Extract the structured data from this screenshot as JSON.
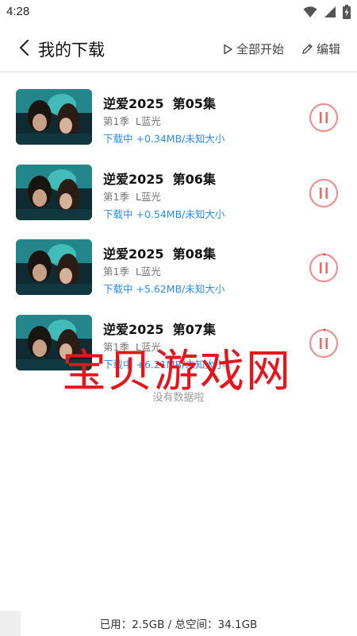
{
  "status_bar": {
    "time": "4:28",
    "icons": [
      "wifi-icon",
      "signal-icon",
      "battery-charging-icon"
    ]
  },
  "header": {
    "title": "我的下载",
    "start_all_label": "全部开始",
    "edit_label": "编辑"
  },
  "downloads": [
    {
      "title": "逆爱2025  第05集",
      "subtitle": "第1季  L蓝光",
      "status": "下载中 +0.34MB/未知大小",
      "progress": 0.0
    },
    {
      "title": "逆爱2025  第06集",
      "subtitle": "第1季  L蓝光",
      "status": "下载中 +0.54MB/未知大小",
      "progress": 0.0
    },
    {
      "title": "逆爱2025  第08集",
      "subtitle": "第1季  L蓝光",
      "status": "下载中 +5.62MB/未知大小",
      "progress": 0.02
    },
    {
      "title": "逆爱2025  第07集",
      "subtitle": "第1季  L蓝光",
      "status": "下载中 +6.21MB/未知大小",
      "progress": 0.02
    }
  ],
  "empty_hint": "没有数据啦",
  "watermark": "宝贝游戏网",
  "storage": {
    "text": "已用：2.5GB / 总空间：34.1GB"
  },
  "colors": {
    "accent_blue": "#2b8cf0",
    "pause_red": "#f07070",
    "watermark_red": "#e8141c"
  }
}
